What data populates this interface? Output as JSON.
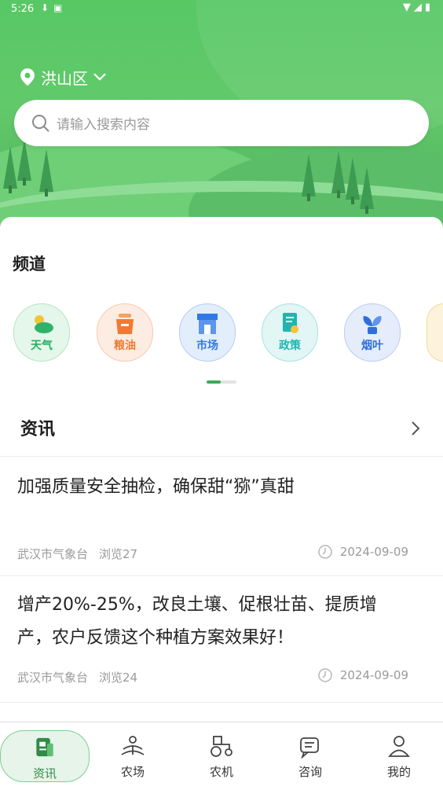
{
  "status_bar": {
    "time": "5:26"
  },
  "location": {
    "name": "洪山区"
  },
  "search": {
    "placeholder": "请输入搜索内容"
  },
  "channels_section": {
    "title": "频道",
    "items": [
      {
        "label": "天气",
        "icon": "weather-icon",
        "color": "#27b060",
        "bg": "#e4f7ea"
      },
      {
        "label": "粮油",
        "icon": "grain-oil-icon",
        "color": "#f07a33",
        "bg": "#fdece2"
      },
      {
        "label": "市场",
        "icon": "market-icon",
        "color": "#2f78e6",
        "bg": "#e3eefc"
      },
      {
        "label": "政策",
        "icon": "policy-icon",
        "color": "#1fb5b0",
        "bg": "#e1f6f5"
      },
      {
        "label": "烟叶",
        "icon": "tobacco-leaf-icon",
        "color": "#2f6fdc",
        "bg": "#e5edfb"
      }
    ]
  },
  "news_section": {
    "title": "资讯",
    "items": [
      {
        "headline": "加强质量安全抽检，确保甜“猕”真甜",
        "source": "武汉市气象台",
        "views": "浏览27",
        "date": "2024-09-09"
      },
      {
        "headline": "增产20%-25%，改良土壤、促根壮苗、提质增产，农户反馈这个种植方案效果好！",
        "source": "武汉市气象台",
        "views": "浏览24",
        "date": "2024-09-09"
      }
    ]
  },
  "tabbar": {
    "active_color": "#2f8b45",
    "items": [
      {
        "label": "资讯",
        "icon": "news-icon",
        "active": true
      },
      {
        "label": "农场",
        "icon": "farm-icon",
        "active": false
      },
      {
        "label": "农机",
        "icon": "tractor-icon",
        "active": false
      },
      {
        "label": "咨询",
        "icon": "chat-icon",
        "active": false
      },
      {
        "label": "我的",
        "icon": "user-icon",
        "active": false
      }
    ]
  }
}
